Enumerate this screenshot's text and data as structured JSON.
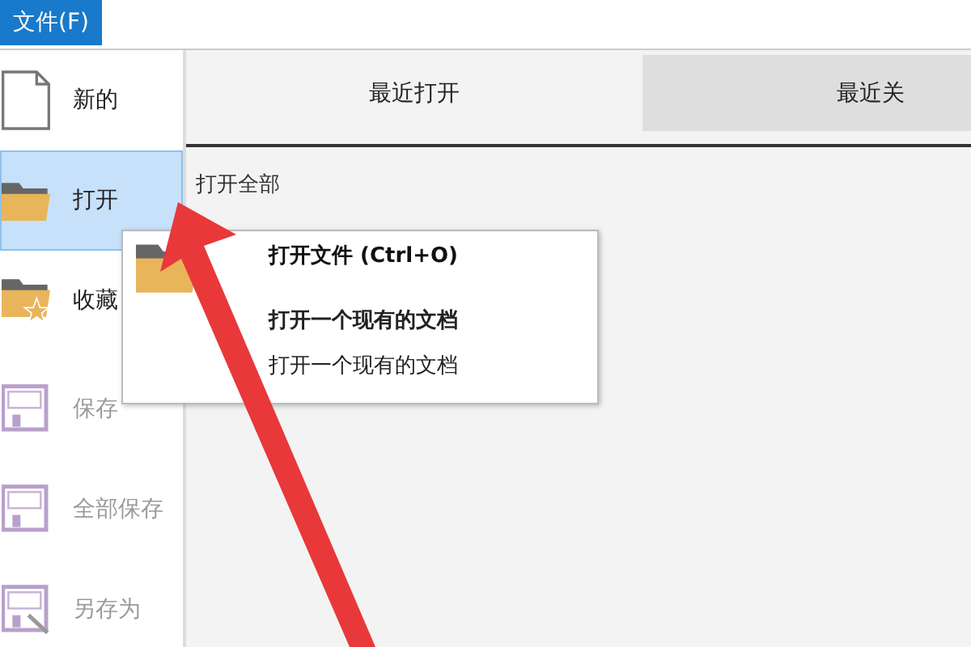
{
  "menu_bar": {
    "file_menu": "文件(F)"
  },
  "sidebar": {
    "items": [
      {
        "label": "新的",
        "kind": "document",
        "selected": false,
        "disabled": false
      },
      {
        "label": "打开",
        "kind": "folder",
        "selected": true,
        "disabled": false
      },
      {
        "label": "收藏",
        "kind": "favorites",
        "selected": false,
        "disabled": false
      },
      {
        "label": "保存",
        "kind": "save",
        "selected": false,
        "disabled": true
      },
      {
        "label": "全部保存",
        "kind": "save",
        "selected": false,
        "disabled": true
      },
      {
        "label": "另存为",
        "kind": "saveas",
        "selected": false,
        "disabled": true
      }
    ]
  },
  "tabs": [
    {
      "label": "最近打开",
      "selected": true
    },
    {
      "label": "最近关",
      "selected": false
    }
  ],
  "open_all": "打开全部",
  "tooltip": {
    "title": "打开文件 (Ctrl+O)",
    "lines": [
      {
        "text": "打开一个现有的文档",
        "bold": true
      },
      {
        "text": "打开一个现有的文档",
        "bold": false
      }
    ]
  }
}
